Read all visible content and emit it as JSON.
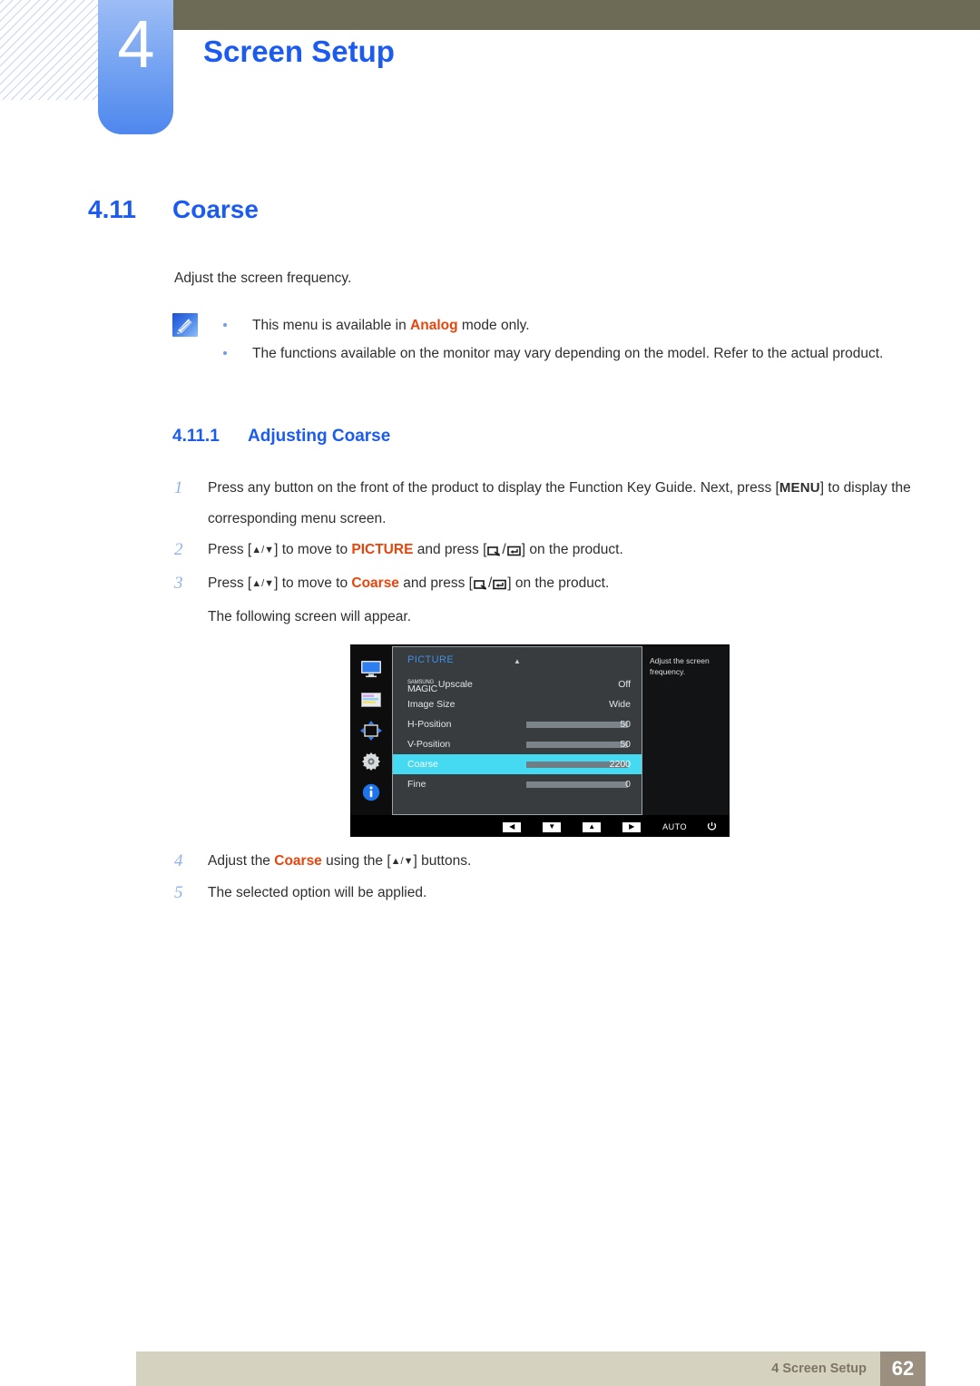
{
  "header": {
    "chapter_number": "4",
    "chapter_title": "Screen Setup"
  },
  "section": {
    "number": "4.11",
    "title": "Coarse",
    "intro": "Adjust the screen frequency."
  },
  "note": {
    "icon": "note-pencil-icon",
    "items": [
      {
        "prefix": "This menu is available in ",
        "highlight": "Analog",
        "suffix": " mode only."
      },
      {
        "prefix": "The functions available on the monitor may vary depending on the model. Refer to the actual product.",
        "highlight": "",
        "suffix": ""
      }
    ]
  },
  "subsection": {
    "number": "4.11.1",
    "title": "Adjusting Coarse"
  },
  "steps": [
    {
      "n": "1",
      "t1": "Press any button on the front of the product to display the Function Key Guide. Next, press [",
      "kbd": "MENU",
      "t2": "] to display the corresponding menu screen."
    },
    {
      "n": "2",
      "t1": "Press [",
      "arrows": "▲/▼",
      "t2": "] to move to ",
      "hl": "PICTURE",
      "t3": " and press [",
      "t4": "] on the product."
    },
    {
      "n": "3",
      "t1": "Press [",
      "arrows": "▲/▼",
      "t2": "] to move to ",
      "hl": "Coarse",
      "t3": " and press [",
      "t4": "] on the product.",
      "extra": "The following screen will appear."
    }
  ],
  "steps_after": [
    {
      "n": "4",
      "t1": "Adjust the ",
      "hl": "Coarse",
      "t2": " using the [",
      "arrows": "▲/▼",
      "t3": "] buttons."
    },
    {
      "n": "5",
      "t1": "The selected option will be applied.",
      "hl": "",
      "t2": "",
      "arrows": "",
      "t3": ""
    }
  ],
  "osd": {
    "title": "PICTURE",
    "sidebar_icons": [
      "monitor-icon",
      "color-bars-icon",
      "position-arrows-icon",
      "gear-icon",
      "info-icon"
    ],
    "rows": [
      {
        "label_small": "SAMSUNG",
        "label_big": "MAGIC",
        "label": "Upscale",
        "value": "Off",
        "slider": null,
        "selected": false
      },
      {
        "label": "Image Size",
        "value": "Wide",
        "slider": null,
        "selected": false
      },
      {
        "label": "H-Position",
        "value": "50",
        "slider": 50,
        "selected": false
      },
      {
        "label": "V-Position",
        "value": "50",
        "slider": 50,
        "selected": false
      },
      {
        "label": "Coarse",
        "value": "2200",
        "slider": 50,
        "selected": true
      },
      {
        "label": "Fine",
        "value": "0",
        "slider": 0,
        "selected": false
      }
    ],
    "description": "Adjust the screen frequency.",
    "buttons": [
      {
        "name": "left-arrow-button",
        "glyph": "◀"
      },
      {
        "name": "down-arrow-button",
        "glyph": "▼"
      },
      {
        "name": "up-arrow-button",
        "glyph": "▲"
      },
      {
        "name": "right-arrow-button",
        "glyph": "▶"
      }
    ],
    "auto_label": "AUTO",
    "power_glyph": "⏻"
  },
  "footer": {
    "text": "4 Screen Setup",
    "page": "62"
  }
}
